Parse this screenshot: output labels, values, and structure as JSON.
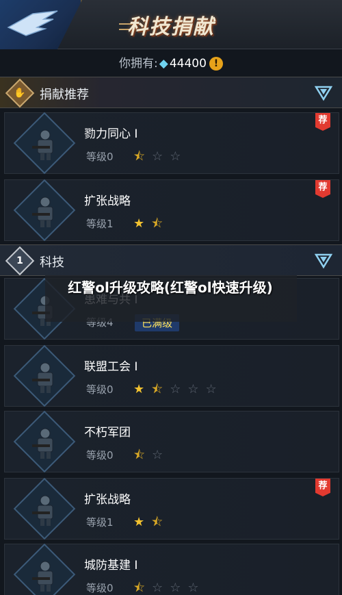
{
  "header": {
    "title": "科技捐献"
  },
  "balance": {
    "label": "你拥有:",
    "gem_icon": "gem-icon",
    "amount": "44400",
    "warn_glyph": "!"
  },
  "sections": {
    "recommended": {
      "label": "捐献推荐"
    },
    "tech": {
      "label": "科技",
      "badge": "1"
    }
  },
  "recommended_items": [
    {
      "name": "勠力同心 I",
      "level": "等级0",
      "stars_full": 0,
      "stars_half": 1,
      "stars_total": 3,
      "badge": "荐"
    },
    {
      "name": "扩张战略",
      "level": "等级1",
      "stars_full": 1,
      "stars_half": 1,
      "stars_total": 2,
      "badge": "荐"
    }
  ],
  "tech_items": [
    {
      "name": "患难与共 I",
      "level": "等级4",
      "status": "已满级"
    },
    {
      "name": "联盟工会 I",
      "level": "等级0",
      "stars_full": 1,
      "stars_half": 1,
      "stars_total": 5
    },
    {
      "name": "不朽军团",
      "level": "等级0",
      "stars_full": 0,
      "stars_half": 1,
      "stars_total": 2
    },
    {
      "name": "扩张战略",
      "level": "等级1",
      "stars_full": 1,
      "stars_half": 1,
      "stars_total": 2,
      "badge": "荐"
    },
    {
      "name": "城防基建 I",
      "level": "等级0",
      "stars_full": 0,
      "stars_half": 1,
      "stars_total": 4
    }
  ],
  "overlay": {
    "text": "红警ol升级攻略(红警ol快速升级)"
  },
  "colors": {
    "accent_gold": "#f2c230",
    "recommend_red": "#e23a30",
    "maxed_yellow": "#ffe25a"
  }
}
